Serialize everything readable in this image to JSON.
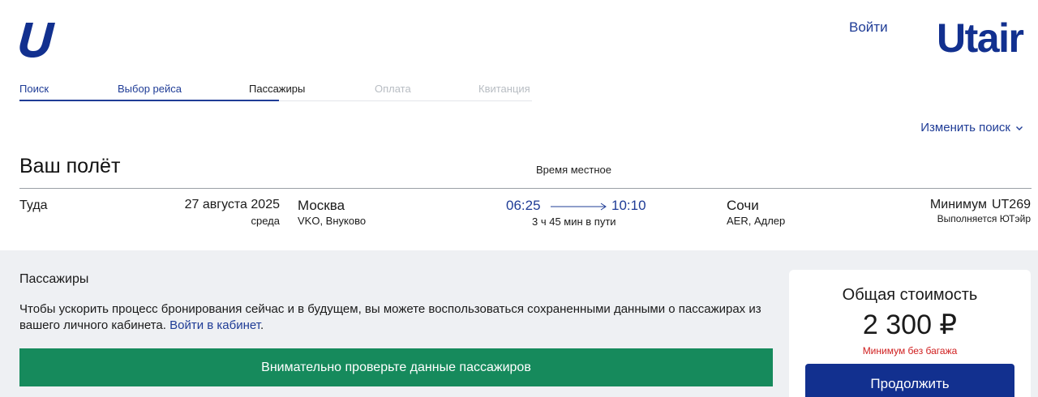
{
  "header": {
    "logo_icon": "utair-u-icon",
    "login_label": "Войти",
    "brand": "Utair"
  },
  "steps": [
    {
      "label": "Поиск",
      "state": "done"
    },
    {
      "label": "Выбор рейса",
      "state": "done"
    },
    {
      "label": "Пассажиры",
      "state": "current"
    },
    {
      "label": "Оплата",
      "state": "future"
    },
    {
      "label": "Квитанция",
      "state": "future"
    }
  ],
  "change_search": {
    "label": "Изменить поиск",
    "icon": "chevron-down-icon"
  },
  "flight": {
    "title": "Ваш полёт",
    "local_time_note": "Время местное",
    "segment": {
      "direction": "Туда",
      "date": "27 августа 2025",
      "weekday": "среда",
      "from_city": "Москва",
      "from_airport": "VKO, Внуково",
      "departure": "06:25",
      "arrival": "10:10",
      "duration": "3 ч 45 мин в пути",
      "to_city": "Сочи",
      "to_airport": "AER, Адлер",
      "fare": "Минимум",
      "flight_number": "UT269",
      "operator": "Выполняется ЮТэйр"
    }
  },
  "passengers": {
    "title": "Пассажиры",
    "info_text": "Чтобы ускорить процесс бронирования сейчас и в будущем, вы можете воспользоваться сохраненными данными о пассажирах из вашего личного кабинета.",
    "cabinet_link": "Войти в кабинет",
    "banner": "Внимательно проверьте данные пассажиров"
  },
  "summary": {
    "label": "Общая стоимость",
    "price": "2 300 ₽",
    "note": "Минимум без багажа",
    "continue_label": "Продолжить"
  },
  "colors": {
    "brand_blue": "#12308f",
    "link_blue": "#1f3c96",
    "banner_green": "#168a5c",
    "note_red": "#d02020",
    "panel_bg": "#eef0f3"
  }
}
